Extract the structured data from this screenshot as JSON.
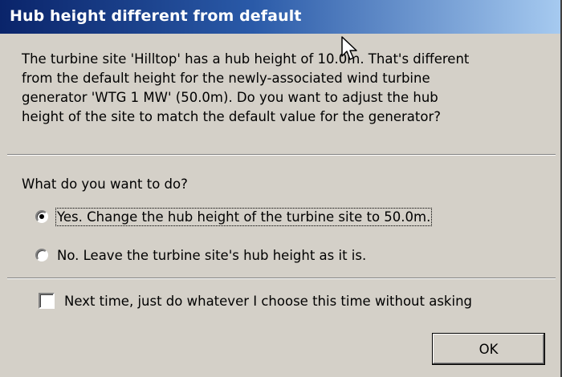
{
  "window": {
    "title": "Hub height different from default"
  },
  "message": {
    "lines": [
      "The turbine site 'Hilltop' has a hub height of 10.0m. That's different",
      "from the default height for the newly-associated wind turbine",
      "generator 'WTG 1 MW' (50.0m). Do you want to adjust the hub",
      "height of the site to match the default value for the generator?"
    ]
  },
  "question": "What do you want to do?",
  "options": [
    {
      "label": "Yes. Change the hub height of the turbine site to 50.0m.",
      "selected": true
    },
    {
      "label": "No. Leave the turbine site's hub height as it is.",
      "selected": false
    }
  ],
  "remember_checkbox": {
    "label": "Next time, just do whatever I choose this time without asking",
    "checked": false
  },
  "buttons": {
    "ok": "OK"
  },
  "colors": {
    "title_start": "#0a246a",
    "title_end": "#a6caf0",
    "face": "#d4d0c8"
  },
  "icons": {
    "cursor": "mouse-pointer-icon"
  }
}
